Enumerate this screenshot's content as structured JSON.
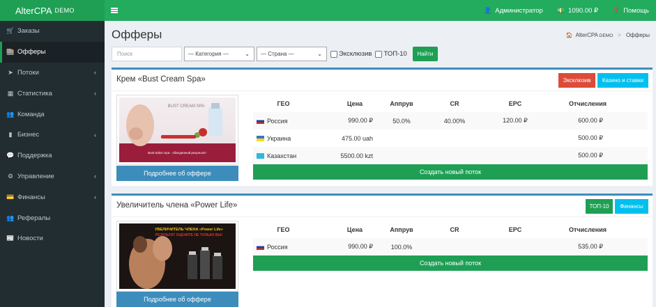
{
  "brand": {
    "name": "AlterCPA",
    "suffix": "DEMO"
  },
  "topbar": {
    "user": "Администратор",
    "balance": "1090.00 ₽",
    "help": "Помощь"
  },
  "sidebar": {
    "items": [
      {
        "label": "Заказы",
        "icon": "cart-icon",
        "glyph": "🛒",
        "active": false,
        "arrow": false
      },
      {
        "label": "Офферы",
        "icon": "shop-icon",
        "glyph": "🏬",
        "active": true,
        "arrow": false
      },
      {
        "label": "Потоки",
        "icon": "send-icon",
        "glyph": "➤",
        "active": false,
        "arrow": true
      },
      {
        "label": "Статистика",
        "icon": "chart-icon",
        "glyph": "▦",
        "active": false,
        "arrow": true
      },
      {
        "label": "Команда",
        "icon": "users-icon",
        "glyph": "👥",
        "active": false,
        "arrow": false
      },
      {
        "label": "Бизнес",
        "icon": "bar-chart-icon",
        "glyph": "▮",
        "active": false,
        "arrow": true
      },
      {
        "label": "Поддержка",
        "icon": "comments-icon",
        "glyph": "💬",
        "active": false,
        "arrow": false
      },
      {
        "label": "Управление",
        "icon": "gears-icon",
        "glyph": "⚙",
        "active": false,
        "arrow": true
      },
      {
        "label": "Финансы",
        "icon": "wallet-icon",
        "glyph": "💳",
        "active": false,
        "arrow": true
      },
      {
        "label": "Рефералы",
        "icon": "referrals-icon",
        "glyph": "👥",
        "active": false,
        "arrow": false
      },
      {
        "label": "Новости",
        "icon": "newspaper-icon",
        "glyph": "📰",
        "active": false,
        "arrow": false
      }
    ],
    "arrow_glyph": "‹"
  },
  "page": {
    "title": "Офферы",
    "breadcrumb": {
      "home": "AlterCPA",
      "home_suffix": "DEMO",
      "current": "Офферы"
    }
  },
  "filters": {
    "search_placeholder": "Поиск",
    "category": "— Категория —",
    "country": "— Страна —",
    "exclusive_label": "Эксклюзив",
    "top_label": "ТОП-10",
    "find_button": "Найти"
  },
  "table_headers": {
    "geo": "ГЕО",
    "price": "Цена",
    "approve": "Аппрув",
    "cr": "CR",
    "epc": "EPC",
    "payout": "Отчисления"
  },
  "offers": [
    {
      "title": "Крем «Bust Cream Spa»",
      "tags": [
        "Эксклюзив",
        "Казино и ставки"
      ],
      "tag_colors": [
        "#dd4b39",
        "#00c0ef"
      ],
      "thumb_text": [
        "BUST CREAM SPA",
        "Bust Salon Spa - обалденный результат!"
      ],
      "more_button": "Подробнее об оффере",
      "create_button": "Создать новый поток",
      "rows": [
        {
          "flag": "ru",
          "geo": "Россия",
          "price": "990.00 ₽",
          "approve": "50.0%",
          "cr": "40.00%",
          "epc": "120.00 ₽",
          "payout": "600.00 ₽"
        },
        {
          "flag": "ua",
          "geo": "Украина",
          "price": "475.00 uah",
          "approve": "",
          "cr": "",
          "epc": "",
          "payout": "500.00 ₽"
        },
        {
          "flag": "kz",
          "geo": "Казахстан",
          "price": "5500.00 kzt",
          "approve": "",
          "cr": "",
          "epc": "",
          "payout": "500.00 ₽"
        }
      ]
    },
    {
      "title": "Увеличитель члена «Power Life»",
      "tags": [
        "ТОП-10",
        "Финансы"
      ],
      "tag_colors": [
        "#1e9f54",
        "#00c0ef"
      ],
      "thumb_text": [
        "УВЕЛИЧИТЕЛЬ ЧЛЕНА «Power Life»",
        "РЕЗУЛЬТАТ ОЦЕНИТЕ НЕ ТОЛЬКО ВЫ!"
      ],
      "more_button": "Подробнее об оффере",
      "create_button": "Создать новый поток",
      "rows": [
        {
          "flag": "ru",
          "geo": "Россия",
          "price": "990.00 ₽",
          "approve": "100.0%",
          "cr": "",
          "epc": "",
          "payout": "535.00 ₽"
        }
      ]
    }
  ]
}
